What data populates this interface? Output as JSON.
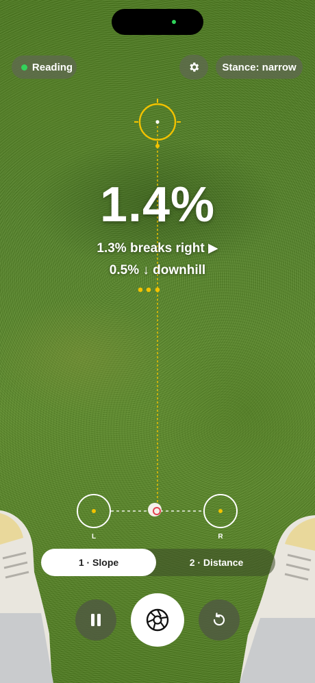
{
  "status": {
    "label": "Reading",
    "indicator_color": "#33d35b"
  },
  "stance": {
    "label": "Stance: narrow"
  },
  "readout": {
    "slope": "1.4%",
    "break_line": "1.3% breaks right ▶",
    "downhill_line": "0.5% ↓ downhill"
  },
  "markers": {
    "left_label": "L",
    "right_label": "R"
  },
  "modes": {
    "slope_label": "1 · Slope",
    "distance_label": "2 · Distance",
    "active": "1 · Slope"
  },
  "icons": {
    "settings": "gear-icon",
    "pause": "pause-icon",
    "capture": "aperture-icon",
    "reset": "rotate-ccw-icon"
  },
  "colors": {
    "accent": "#f2c200",
    "reading_dot": "#33d35b"
  }
}
